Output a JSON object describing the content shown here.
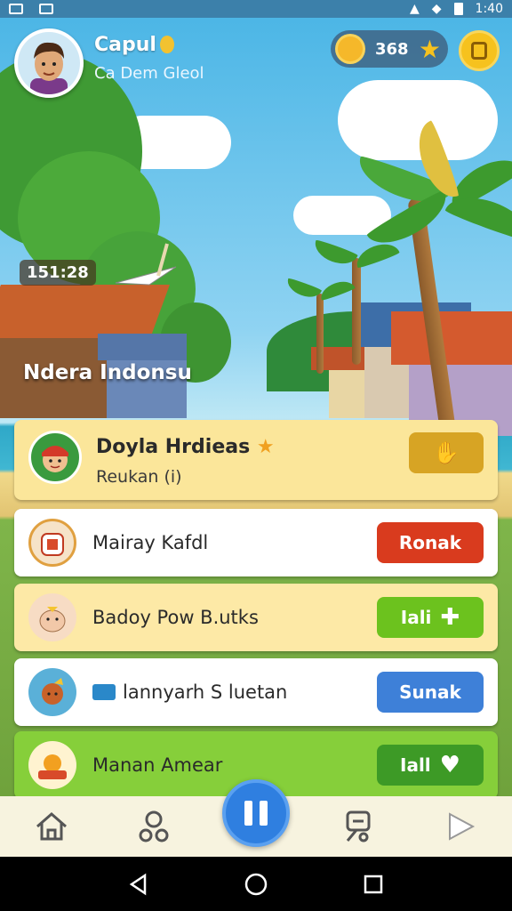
{
  "status_bar": {
    "time": "1:40"
  },
  "header": {
    "player_name": "Capul",
    "player_subtitle": "Ca Dem Gleol",
    "currency_value": "368",
    "avatar_icon": "boy-avatar-icon",
    "menu_icon": "scroll-icon"
  },
  "scene": {
    "timer": "151:28",
    "location_title": "Ndera Indonsu"
  },
  "cards": [
    {
      "title": "Doyla Hrdieas",
      "subtitle": "Reukan (i)",
      "button_label": "",
      "icon": "girl-avatar-icon",
      "button_color": "#d7a424"
    },
    {
      "title": "Mairay Kafdl",
      "button_label": "Ronak",
      "icon": "jar-icon",
      "button_color": "#d93b1e"
    },
    {
      "title": "Badoy Pow B.utks",
      "button_label": "Iali",
      "icon": "hamster-icon",
      "button_color": "#6cc21e"
    },
    {
      "title": "lannyarh S luetan",
      "button_label": "Sunak",
      "icon": "coconut-icon",
      "button_color": "#3e80d8"
    },
    {
      "title": "Manan Amear",
      "button_label": "Iall",
      "icon": "sun-badge-icon",
      "button_color": "#3d9a26"
    }
  ],
  "bottom_nav": [
    "home-icon",
    "friends-icon",
    "pause-icon",
    "quest-icon",
    "play-icon"
  ]
}
